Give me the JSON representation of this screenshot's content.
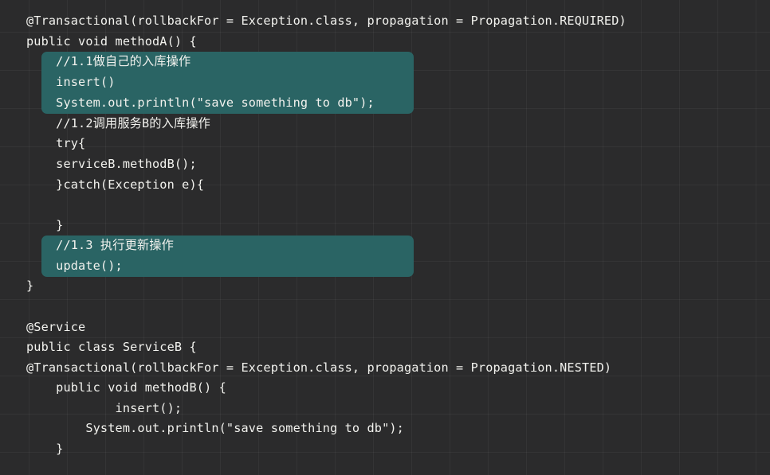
{
  "colors": {
    "background": "#2b2b2c",
    "text": "#f2f2ee",
    "highlight": "#2a6464"
  },
  "code": {
    "lines": [
      "@Transactional(rollbackFor = Exception.class, propagation = Propagation.REQUIRED)",
      "public void methodA() {",
      "    //1.1做自己的入库操作",
      "    insert()",
      "    System.out.println(\"save something to db\");",
      "    //1.2调用服务B的入库操作",
      "    try{",
      "    serviceB.methodB();",
      "    }catch(Exception e){",
      "",
      "    }",
      "    //1.3 执行更新操作",
      "    update();",
      "}",
      "",
      "@Service",
      "public class ServiceB {",
      "@Transactional(rollbackFor = Exception.class, propagation = Propagation.NESTED)",
      "    public void methodB() {",
      "            insert();",
      "        System.out.println(\"save something to db\");",
      "    }"
    ]
  }
}
